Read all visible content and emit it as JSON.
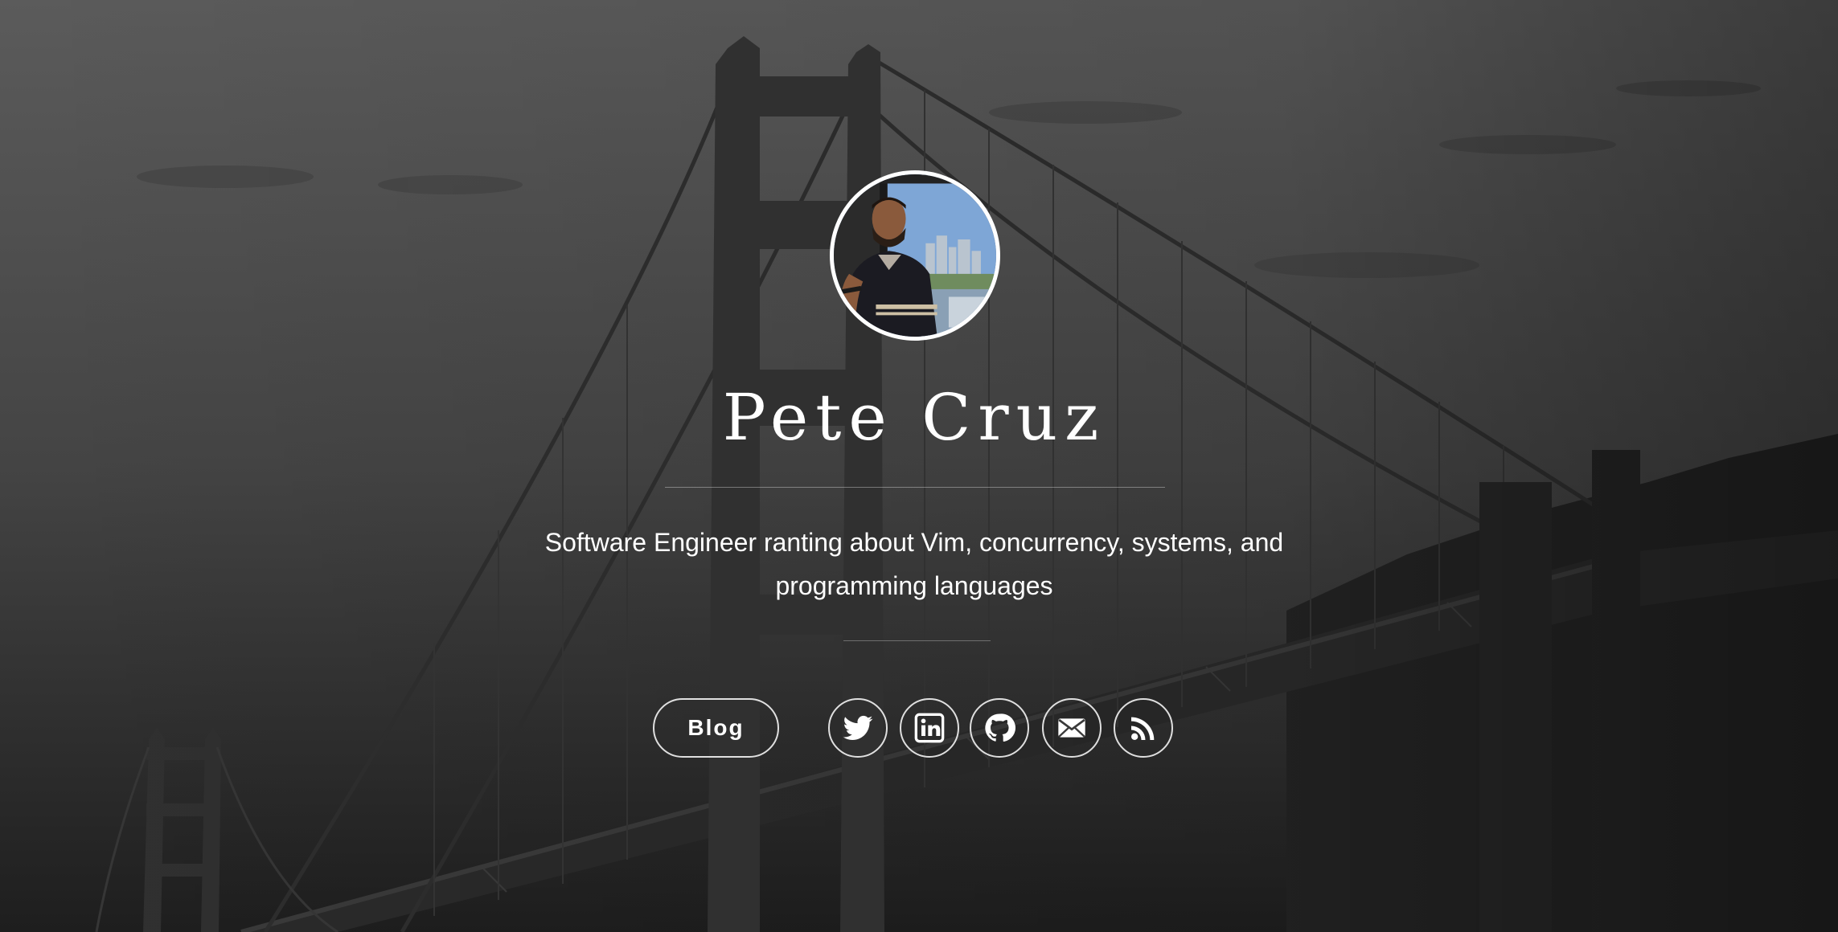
{
  "profile": {
    "name": "Pete Cruz",
    "tagline_line1": "Software Engineer ranting about Vim, concurrency, systems, and",
    "tagline_line2": "programming languages"
  },
  "nav": {
    "blog_label": "Blog"
  },
  "social": [
    {
      "icon": "twitter-icon"
    },
    {
      "icon": "linkedin-icon"
    },
    {
      "icon": "github-icon"
    },
    {
      "icon": "email-icon"
    },
    {
      "icon": "rss-icon"
    }
  ],
  "colors": {
    "text": "#ffffff",
    "background_top": "#5a5a5a",
    "background_bottom": "#1c1c1c"
  }
}
